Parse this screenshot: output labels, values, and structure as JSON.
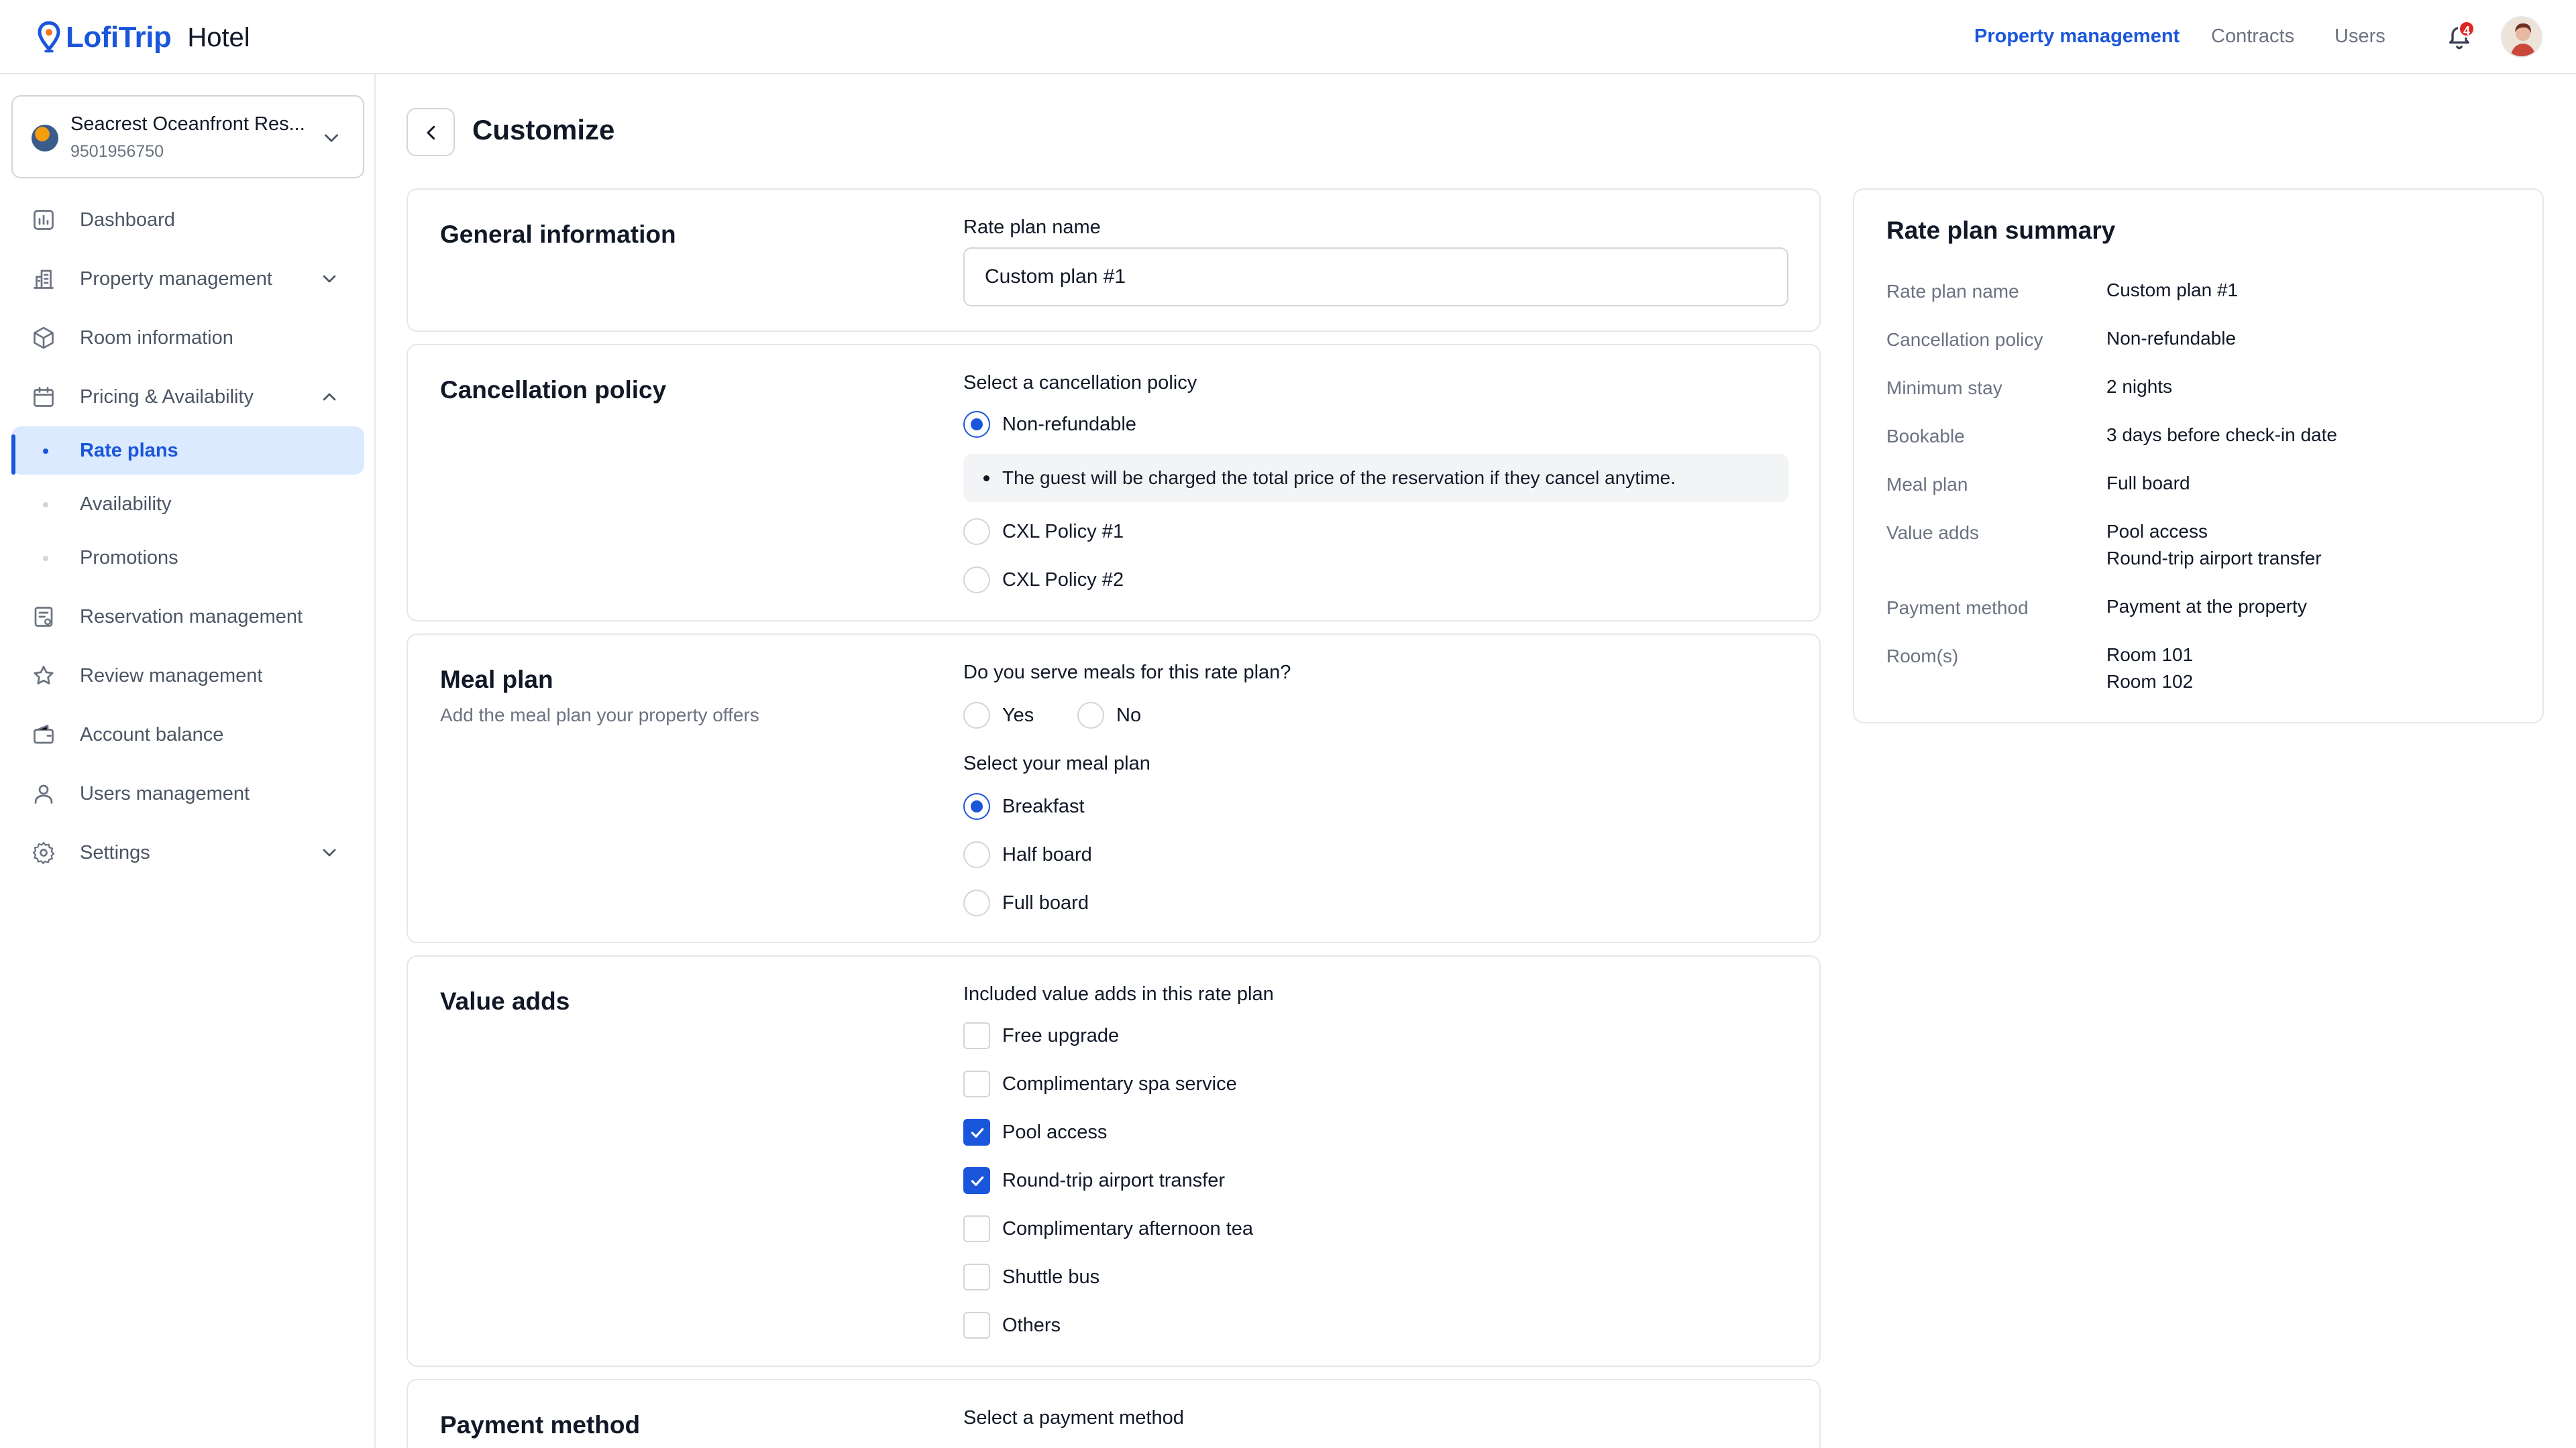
{
  "header": {
    "brand": "LofiTrip",
    "product": "Hotel",
    "nav": [
      "Property management",
      "Contracts",
      "Users"
    ],
    "active_nav": "Property management",
    "notification_count": "4",
    "accent": "#1a56db"
  },
  "property": {
    "name": "Seacrest Oceanfront Res...",
    "id": "9501956750"
  },
  "sidebar": {
    "items": [
      {
        "label": "Dashboard",
        "icon": "chart-icon"
      },
      {
        "label": "Property management",
        "icon": "building-icon"
      },
      {
        "label": "Room information",
        "icon": "cube-icon"
      },
      {
        "label": "Pricing & Availability",
        "icon": "calendar-icon"
      },
      {
        "label": "Reservation management",
        "icon": "reservation-icon"
      },
      {
        "label": "Review management",
        "icon": "star-icon"
      },
      {
        "label": "Account balance",
        "icon": "wallet-icon"
      },
      {
        "label": "Users management",
        "icon": "user-icon"
      },
      {
        "label": "Settings",
        "icon": "gear-icon"
      }
    ],
    "sub_items": [
      "Rate plans",
      "Availability",
      "Promotions"
    ],
    "active_sub": "Rate plans"
  },
  "page": {
    "title": "Customize"
  },
  "general": {
    "title": "General information",
    "field_label": "Rate plan name",
    "field_value": "Custom plan #1"
  },
  "cancellation": {
    "title": "Cancellation policy",
    "question": "Select a cancellation policy",
    "options": [
      "Non-refundable",
      "CXL Policy #1",
      "CXL Policy #2"
    ],
    "selected": "Non-refundable",
    "note": "The guest will be charged the total price of the reservation if they cancel anytime."
  },
  "meal": {
    "title": "Meal plan",
    "subtitle": "Add the meal plan your property offers",
    "serve_question": "Do you serve meals for this rate plan?",
    "serve_options": [
      "Yes",
      "No"
    ],
    "select_question": "Select your meal plan",
    "plans": [
      "Breakfast",
      "Half board",
      "Full board"
    ],
    "selected_plan": "Breakfast"
  },
  "value_adds": {
    "title": "Value adds",
    "question": "Included value adds in this rate plan",
    "options": [
      {
        "label": "Free upgrade",
        "checked": false
      },
      {
        "label": "Complimentary spa service",
        "checked": false
      },
      {
        "label": "Pool access",
        "checked": true
      },
      {
        "label": "Round-trip airport transfer",
        "checked": true
      },
      {
        "label": "Complimentary afternoon tea",
        "checked": false
      },
      {
        "label": "Shuttle bus",
        "checked": false
      },
      {
        "label": "Others",
        "checked": false
      }
    ]
  },
  "payment": {
    "title": "Payment method",
    "question": "Select a payment method"
  },
  "summary": {
    "title": "Rate plan summary",
    "rows": [
      {
        "key": "Rate plan name",
        "value": "Custom plan #1"
      },
      {
        "key": "Cancellation policy",
        "value": "Non-refundable"
      },
      {
        "key": "Minimum stay",
        "value": "2 nights"
      },
      {
        "key": "Bookable",
        "value": "3 days before check-in date"
      },
      {
        "key": "Meal plan",
        "value": "Full board"
      },
      {
        "key": "Value adds",
        "value": "Pool access",
        "value2": "Round-trip airport transfer"
      },
      {
        "key": "Payment method",
        "value": "Payment at the property"
      },
      {
        "key": "Room(s)",
        "value": "Room 101",
        "value2": "Room 102"
      }
    ]
  }
}
